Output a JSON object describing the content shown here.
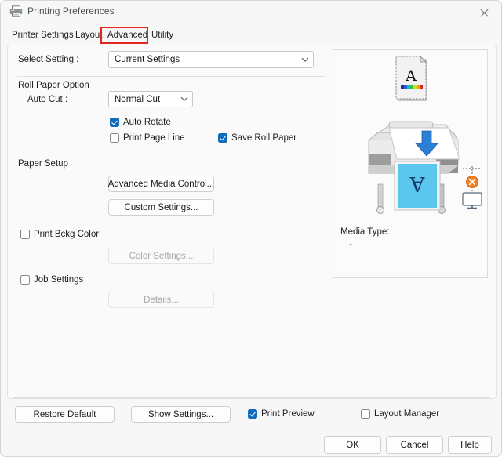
{
  "window": {
    "title": "Printing Preferences",
    "printer_icon": "printer-icon",
    "close_icon": "close-icon"
  },
  "tabs": [
    {
      "label": "Printer Settings",
      "selected": false
    },
    {
      "label": "Layout",
      "selected": false
    },
    {
      "label": "Advanced",
      "selected": true,
      "highlight_color": "#e12721"
    },
    {
      "label": "Utility",
      "selected": false
    }
  ],
  "select_setting": {
    "label": "Select Setting :",
    "value": "Current Settings",
    "chevron": "⌄"
  },
  "roll_paper": {
    "group_label": "Roll Paper Option",
    "auto_cut_label": "Auto Cut :",
    "auto_cut_value": "Normal Cut",
    "chevron": "⌄",
    "auto_rotate": {
      "label": "Auto Rotate",
      "checked": true
    },
    "print_page_line": {
      "label": "Print Page Line",
      "checked": false
    },
    "save_roll_paper": {
      "label": "Save Roll Paper",
      "checked": true
    }
  },
  "paper_setup": {
    "group_label": "Paper Setup",
    "advanced_media_control": "Advanced Media Control...",
    "custom_settings": "Custom Settings..."
  },
  "options": {
    "print_bckg_color": {
      "label": "Print Bckg Color",
      "checked": false
    },
    "color_settings": {
      "label": "Color Settings...",
      "enabled": false
    },
    "job_settings": {
      "label": "Job Settings",
      "checked": false
    },
    "details": {
      "label": "Details...",
      "enabled": false
    }
  },
  "preview": {
    "media_type_label": "Media Type:",
    "media_type_value": "-",
    "document_icon": "document-preview-icon",
    "printer_icon": "large-format-printer-icon",
    "status_icon": "connection-error-icon",
    "monitor_icon": "monitor-icon",
    "accent_cyan": "#5bc6ee",
    "accent_blue": "#1d6fc4",
    "error_orange": "#f08020"
  },
  "footer": {
    "restore_default": "Restore Default",
    "show_settings": "Show Settings...",
    "print_preview": {
      "label": "Print Preview",
      "checked": true
    },
    "layout_manager": {
      "label": "Layout Manager",
      "checked": false
    }
  },
  "dialog_buttons": {
    "ok": "OK",
    "cancel": "Cancel",
    "help": "Help"
  }
}
